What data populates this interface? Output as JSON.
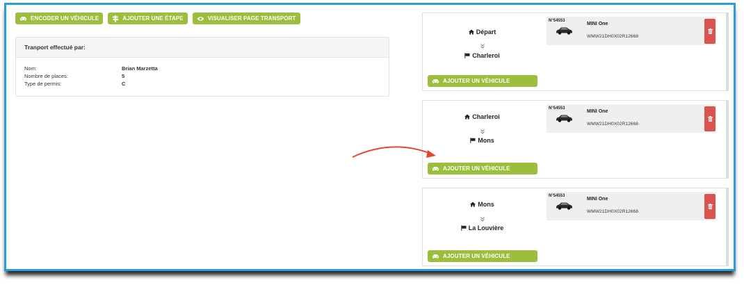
{
  "toolbar": {
    "encode_vehicle": "ENCODER UN VÉHICULE",
    "add_step": "AJOUTER UNE ÉTAPE",
    "view_transport_page": "VISUALISER PAGE TRANSPORT"
  },
  "carrier_panel": {
    "title": "Tranport effectué par:",
    "rows": [
      {
        "label": "Nom:",
        "value": "Brian Marzetta"
      },
      {
        "label": "Nombre de places:",
        "value": "5"
      },
      {
        "label": "Type de permis:",
        "value": "C"
      }
    ]
  },
  "stages": [
    {
      "from": "Départ",
      "to": "Charleroi",
      "add_vehicle_label": "AJOUTER UN VÉHICULE",
      "vehicle": {
        "number": "N°54553",
        "model": "MINI One",
        "vin": "WMW21DH0X02R12668"
      }
    },
    {
      "from": "Charleroi",
      "to": "Mons",
      "add_vehicle_label": "AJOUTER UN VÉHICULE",
      "vehicle": {
        "number": "N°54553",
        "model": "MINI One",
        "vin": "WMW21DH0X02R12668"
      }
    },
    {
      "from": "Mons",
      "to": "La Louvière",
      "add_vehicle_label": "AJOUTER UN VÉHICULE",
      "vehicle": {
        "number": "N°54553",
        "model": "MINI One",
        "vin": "WMW21DH0X02R12668"
      }
    }
  ],
  "colors": {
    "accent_green": "#9bbf3c",
    "delete_red": "#d9534f",
    "frame_blue": "#2a9bdd",
    "annotation_arrow": "#e8452f"
  },
  "icons": {
    "encode_vehicle": "car-icon",
    "add_step": "signpost-icon",
    "view_transport_page": "eye-icon",
    "from": "home-icon",
    "to": "flag-icon",
    "separator": "chevron-double-down-icon",
    "delete": "trash-icon"
  }
}
